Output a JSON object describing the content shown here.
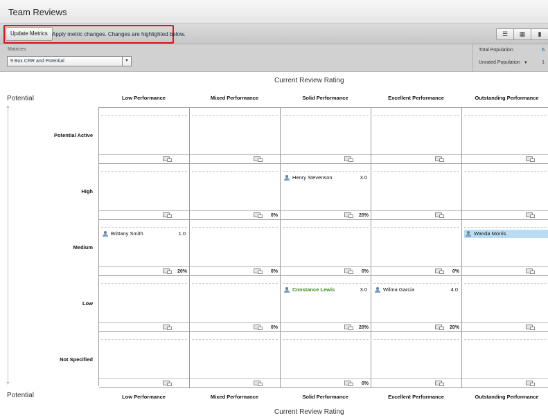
{
  "header": {
    "title": "Team Reviews"
  },
  "toolbar": {
    "update_label": "Update Metrics",
    "message": "Apply metric changes. Changes are highlighted below.",
    "views": [
      {
        "icon": "list-view-icon",
        "glyph": "☰"
      },
      {
        "icon": "grid-view-icon",
        "glyph": "▦"
      },
      {
        "icon": "chart-view-icon",
        "glyph": "▮"
      }
    ]
  },
  "filters": {
    "matrices_label": "Matrices",
    "matrix_value": "9 Box CRR and Potential",
    "total_population_label": "Total Population",
    "total_population_value": "6",
    "unrated_population_label": "Unrated Population",
    "unrated_population_value": "1"
  },
  "matrix": {
    "top_axis_title": "Current Review Rating",
    "bottom_axis_title": "Current Review Rating",
    "left_axis_title_top": "Potential",
    "left_axis_title_bottom": "Potential",
    "columns": [
      "Low Performance",
      "Mixed Performance",
      "Solid Performance",
      "Excellent Performance",
      "Outstanding Performance"
    ],
    "rows": [
      {
        "label": "Potential Active",
        "cells": [
          {
            "pct": "",
            "employees": []
          },
          {
            "pct": "",
            "employees": []
          },
          {
            "pct": "",
            "employees": []
          },
          {
            "pct": "",
            "employees": []
          },
          {
            "pct": "",
            "employees": []
          }
        ]
      },
      {
        "label": "High",
        "cells": [
          {
            "pct": "",
            "employees": []
          },
          {
            "pct": "0%",
            "employees": []
          },
          {
            "pct": "20%",
            "employees": [
              {
                "name": "Henry Stevenson",
                "rating": "3.0",
                "changed": false,
                "selected": false
              }
            ]
          },
          {
            "pct": "",
            "employees": []
          },
          {
            "pct": "",
            "employees": []
          }
        ]
      },
      {
        "label": "Medium",
        "cells": [
          {
            "pct": "20%",
            "employees": [
              {
                "name": "Brittany Smith",
                "rating": "1.0",
                "changed": false,
                "selected": false
              }
            ]
          },
          {
            "pct": "0%",
            "employees": []
          },
          {
            "pct": "0%",
            "employees": []
          },
          {
            "pct": "0%",
            "employees": []
          },
          {
            "pct": "",
            "employees": [
              {
                "name": "Wanda Morris",
                "rating": "",
                "changed": false,
                "selected": true
              }
            ]
          }
        ]
      },
      {
        "label": "Low",
        "cells": [
          {
            "pct": "",
            "employees": []
          },
          {
            "pct": "0%",
            "employees": []
          },
          {
            "pct": "20%",
            "employees": [
              {
                "name": "Constance Lewis",
                "rating": "3.0",
                "changed": true,
                "selected": false
              }
            ]
          },
          {
            "pct": "20%",
            "employees": [
              {
                "name": "Wilma Garcia",
                "rating": "4.0",
                "changed": false,
                "selected": false
              }
            ]
          },
          {
            "pct": "",
            "employees": []
          }
        ]
      },
      {
        "label": "Not Specified",
        "cells": [
          {
            "pct": "",
            "employees": []
          },
          {
            "pct": "",
            "employees": []
          },
          {
            "pct": "0%",
            "employees": []
          },
          {
            "pct": "",
            "employees": []
          },
          {
            "pct": "",
            "employees": []
          }
        ]
      }
    ]
  }
}
